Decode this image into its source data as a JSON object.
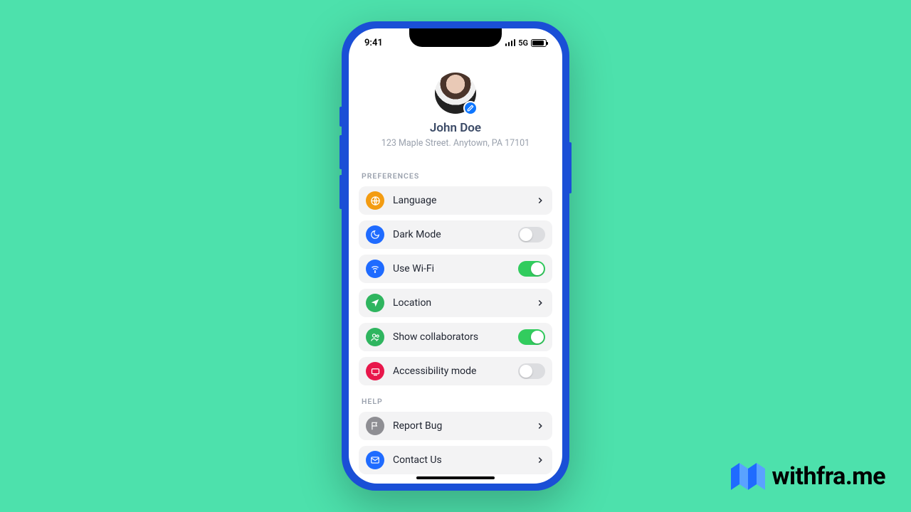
{
  "status": {
    "time": "9:41",
    "network": "5G"
  },
  "profile": {
    "name": "John Doe",
    "address": "123 Maple Street. Anytown, PA 17101",
    "edit_icon": "pencil-icon"
  },
  "sections": {
    "preferences": {
      "header": "PREFERENCES",
      "items": [
        {
          "icon": "globe-icon",
          "icon_color": "#f39c12",
          "label": "Language",
          "control": "chevron"
        },
        {
          "icon": "moon-icon",
          "icon_color": "#1f6bff",
          "label": "Dark Mode",
          "control": "toggle",
          "value": false
        },
        {
          "icon": "wifi-icon",
          "icon_color": "#1f6bff",
          "label": "Use Wi-Fi",
          "control": "toggle",
          "value": true
        },
        {
          "icon": "location-icon",
          "icon_color": "#2fb55f",
          "label": "Location",
          "control": "chevron"
        },
        {
          "icon": "users-icon",
          "icon_color": "#2fb55f",
          "label": "Show collaborators",
          "control": "toggle",
          "value": true
        },
        {
          "icon": "accessibility-icon",
          "icon_color": "#e8174b",
          "label": "Accessibility mode",
          "control": "toggle",
          "value": false
        }
      ]
    },
    "help": {
      "header": "HELP",
      "items": [
        {
          "icon": "flag-icon",
          "icon_color": "#8e8e93",
          "label": "Report Bug",
          "control": "chevron"
        },
        {
          "icon": "mail-icon",
          "icon_color": "#1f6bff",
          "label": "Contact Us",
          "control": "chevron"
        }
      ]
    }
  },
  "brand": {
    "text": "withfra.me"
  }
}
